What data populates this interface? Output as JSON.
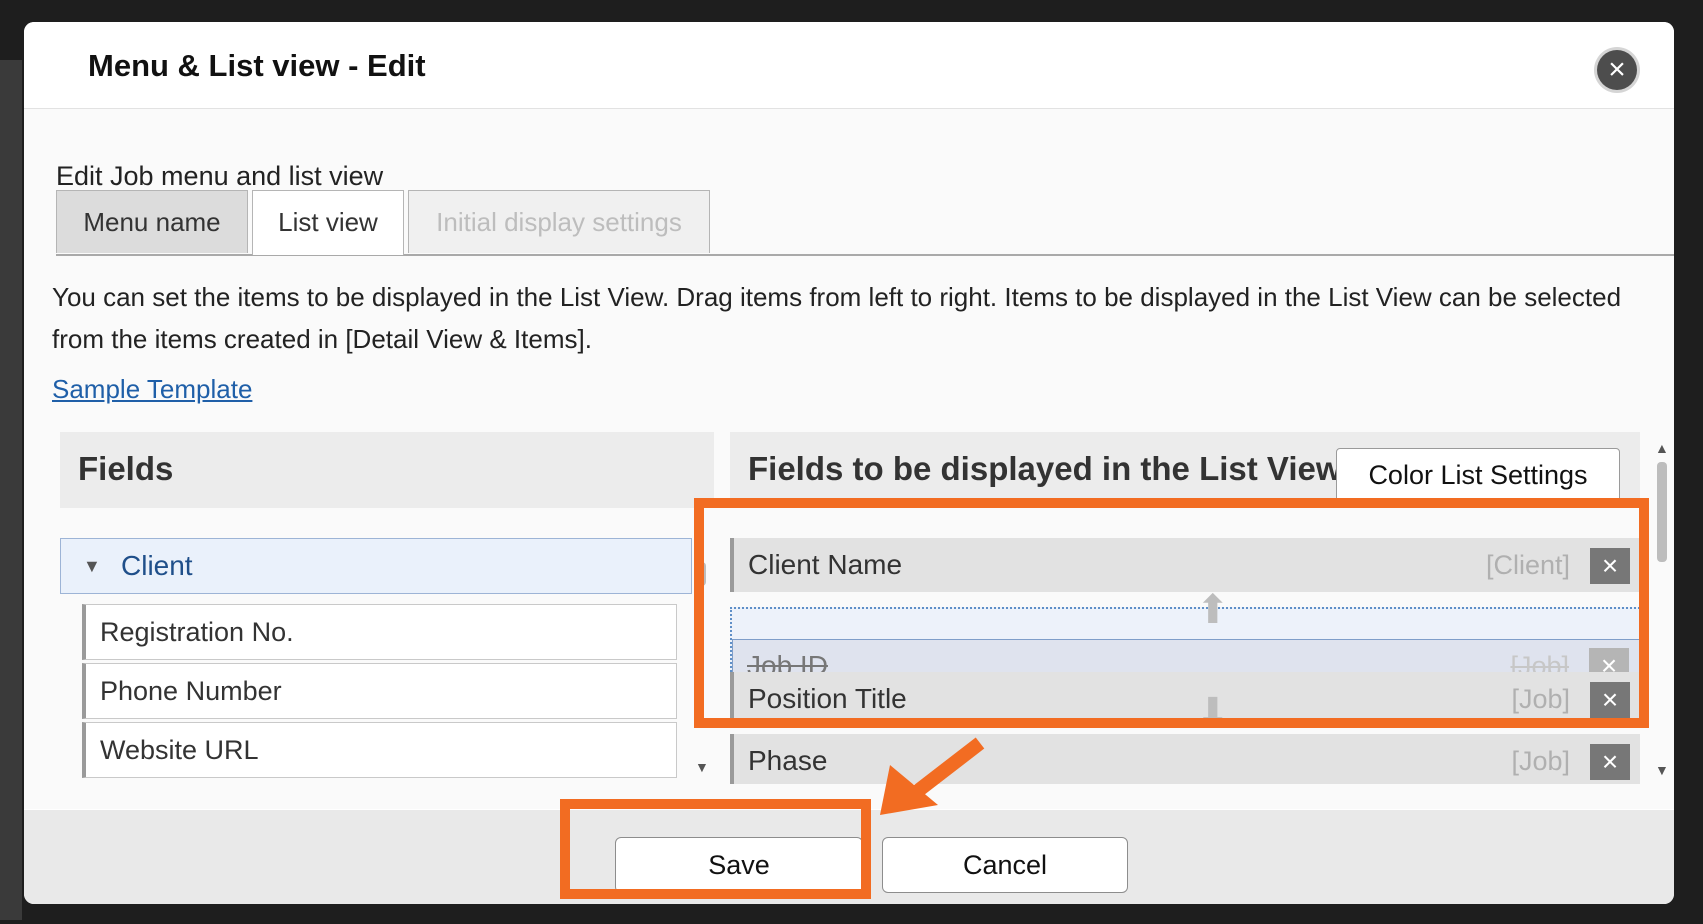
{
  "dialog": {
    "title": "Menu & List view - Edit",
    "close_icon": "×",
    "subtitle": "Edit Job menu and list view"
  },
  "tabs": [
    "Menu name",
    "List view",
    "Initial display settings"
  ],
  "description": "You can set the items to be displayed in the List View. Drag items from left to right. Items to be displayed in the List View can be selected from the items created in [Detail View & Items].",
  "sample_link": "Sample Template",
  "fields_panel": {
    "title": "Fields",
    "group": "Client",
    "items": [
      "Registration No.",
      "Phone Number",
      "Website URL"
    ]
  },
  "list_panel": {
    "title": "Fields to be displayed in the List View",
    "color_button": "Color List Settings",
    "items": [
      {
        "label": "Client Name",
        "tag": "[Client]"
      },
      {
        "label": "Job ID",
        "tag": "[Job]"
      },
      {
        "label": "Position Title",
        "tag": "[Job]"
      },
      {
        "label": "Phase",
        "tag": "[Job]"
      }
    ],
    "remove_icon": "×"
  },
  "footer": {
    "save": "Save",
    "cancel": "Cancel"
  },
  "colors": {
    "highlight": "#f26c22",
    "link": "#1f5fa8"
  }
}
